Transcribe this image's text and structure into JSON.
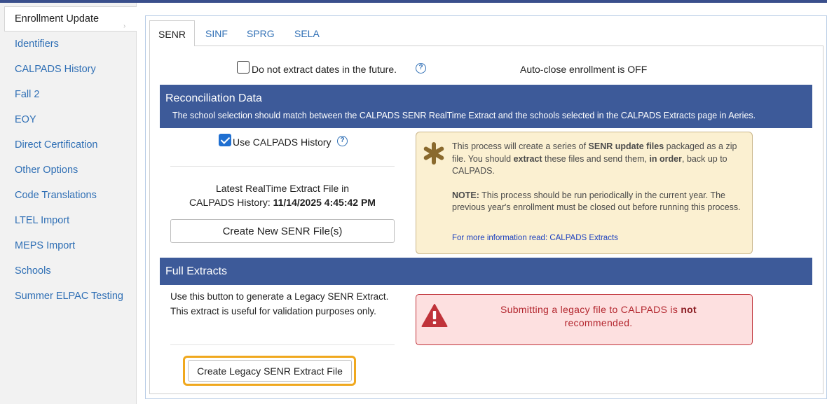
{
  "sidebar": {
    "active": "Enrollment Update",
    "items": [
      "Identifiers",
      "CALPADS History",
      "Fall 2",
      "EOY",
      "Direct Certification",
      "Other Options",
      "Code Translations",
      "LTEL Import",
      "MEPS Import",
      "Schools",
      "Summer ELPAC Testing"
    ]
  },
  "tabs": [
    "SENR",
    "SINF",
    "SPRG",
    "SELA"
  ],
  "options": {
    "no_future_dates_label": "Do not extract dates in the future.",
    "no_future_dates_checked": false,
    "auto_close": "Auto-close enrollment is OFF"
  },
  "reconciliation": {
    "title": "Reconciliation Data",
    "subtitle": "The school selection should match between the CALPADS SENR RealTime Extract and the schools selected in the CALPADS Extracts page in Aeries.",
    "use_history_label": "Use CALPADS History",
    "use_history_checked": true,
    "latest_label_line1": "Latest RealTime Extract File in",
    "latest_label_line2": "CALPADS History:",
    "latest_value": "11/14/2025 4:45:42 PM",
    "create_button": "Create New SENR File(s)"
  },
  "note": {
    "line1_pre": "This process will create a series of ",
    "line1_bold": "SENR update files",
    "line1_post": " packaged as a zip file. You should ",
    "extract_bold": "extract",
    "line1_mid": " these files and send them, ",
    "order_bold": "in order",
    "line1_end": ", back up to CALPADS.",
    "note_bold": "NOTE:",
    "note_text": " This process should be run periodically in the current year. The previous year's enrollment must be closed out before running this process.",
    "link": "For more information read: CALPADS Extracts"
  },
  "full_extracts": {
    "title": "Full Extracts",
    "description": "Use this button to generate a Legacy SENR Extract. This extract is useful for validation purposes only.",
    "button": "Create Legacy SENR Extract File"
  },
  "warning": {
    "text_pre": "Submitting a legacy file to CALPADS is ",
    "text_bold": "not",
    "text_post": " recommended."
  },
  "colors": {
    "accent_band": "#3d5a99",
    "link": "#2f6fb5",
    "warning": "#c0333a",
    "note_bg": "#fbf0d1",
    "highlight": "#f0a81e"
  }
}
